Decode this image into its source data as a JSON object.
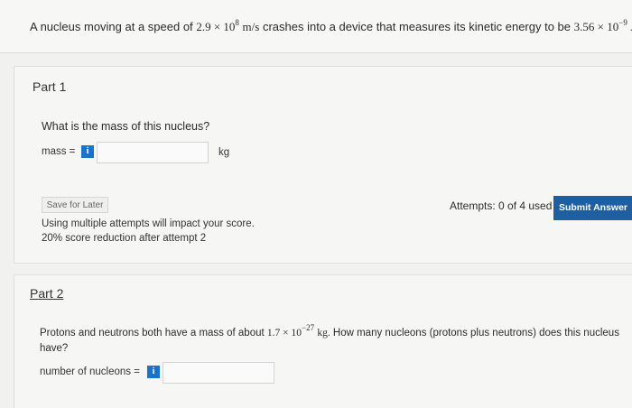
{
  "question": {
    "intro": "A nucleus moving at a speed of",
    "speed_mantissa": "2.9 × 10",
    "speed_exponent": "8",
    "speed_unit": "m/s",
    "middle": "crashes into a device that measures its kinetic energy to be",
    "energy_mantissa": "3.56 × 10",
    "energy_exponent": "−9",
    "energy_unit": "J."
  },
  "part1": {
    "title": "Part 1",
    "prompt": "What is the mass of this nucleus?",
    "field_label": "mass =",
    "info_glyph": "i",
    "input_value": "",
    "unit": "kg",
    "save_label": "Save for Later",
    "attempts_text": "Attempts: 0 of 4 used",
    "submit_label": "Submit Answer",
    "note_line1": "Using multiple attempts will impact your score.",
    "note_line2": "20% score reduction after attempt 2"
  },
  "part2": {
    "title": "Part 2",
    "prompt_before": "Protons and neutrons both have a mass of about",
    "mass_mantissa": "1.7 × 10",
    "mass_exponent": "−27",
    "mass_unit": "kg.",
    "prompt_after": "How many nucleons (protons plus neutrons) does this nucleus have?",
    "field_label": "number of nucleons =",
    "info_glyph": "i",
    "input_value": ""
  },
  "colors": {
    "accent_blue": "#1d5fa0",
    "info_blue": "#1a73c8",
    "page_bg": "#f1f1f0"
  }
}
